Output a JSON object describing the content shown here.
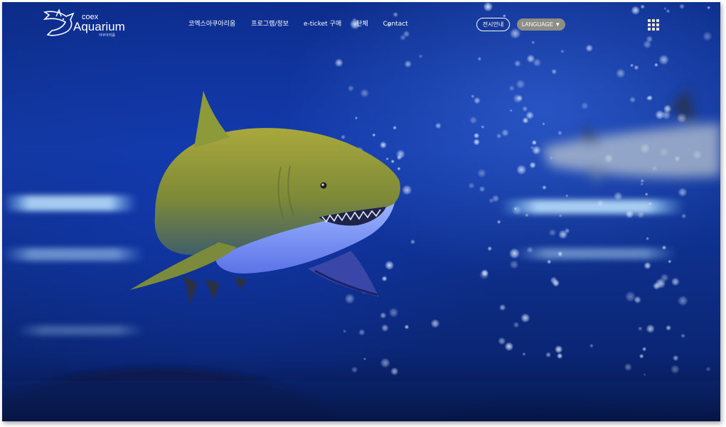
{
  "logo": {
    "small_text": "coex",
    "large_text": "Aquarium",
    "sub_text": "아쿠아리움",
    "icon": "shark-logo-icon"
  },
  "nav": {
    "items": [
      {
        "label": "코엑스아쿠아리움"
      },
      {
        "label": "프로그램/정보"
      },
      {
        "label": "e-ticket 구매"
      },
      {
        "label": "단체"
      },
      {
        "label": "Contact"
      }
    ]
  },
  "header_buttons": {
    "info_label": "전시안내",
    "language_label": "LANGUAGE ▼",
    "menu_icon": "grid-menu-icon"
  },
  "hero": {
    "image": "shark-underwater-hero-image"
  },
  "colors": {
    "background_deep": "#0c2c8a",
    "accent_glow": "#6fa6ff",
    "language_button": "#8e8d86",
    "text": "#ffffff"
  }
}
